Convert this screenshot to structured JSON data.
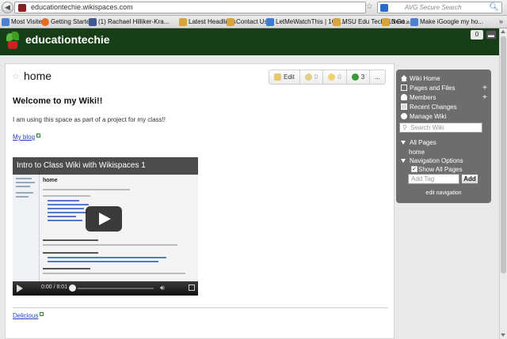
{
  "browser": {
    "url": "educationtechie.wikispaces.com",
    "search_placeholder": "AVG Secure Search",
    "bookmarks": [
      {
        "label": "Most Visited",
        "color": "#4a7fd6"
      },
      {
        "label": "Getting Started",
        "color": "#e66a1f"
      },
      {
        "label": "(1) Rachael Hilliker-Kra...",
        "color": "#3b5998"
      },
      {
        "label": "Latest Headlines",
        "color": "#d9a53a"
      },
      {
        "label": "Contact Us",
        "color": "#d9a53a"
      },
      {
        "label": "LetMeWatchThis | 1Ch...",
        "color": "#3a7bd5"
      },
      {
        "label": "MSU Edu Tech810 Go...",
        "color": "#d9a53a"
      },
      {
        "label": "Next »",
        "color": "#d9a53a"
      },
      {
        "label": "Make iGoogle my ho...",
        "color": "#4a7fd6"
      }
    ],
    "more_icon": "chevron-right-double"
  },
  "header": {
    "site_title": "educationtechie",
    "badge_count": "0"
  },
  "page": {
    "title": "home",
    "actions": {
      "edit_label": "Edit",
      "comments_count": "0",
      "favorites_count": "0",
      "revisions_count": "3",
      "more_label": "..."
    },
    "heading": "Welcome to my Wiki!!",
    "intro": "I am using this space as part of a project for my class!!",
    "blog_link": "My blog",
    "video": {
      "title": "Intro to Class Wiki with Wikispaces 1",
      "inner_page_title": "home",
      "time": "0:00 / 8:01"
    },
    "delicious_link": "Delicious"
  },
  "sidebar": {
    "items": [
      {
        "label": "Wiki Home",
        "icon": "home-icon"
      },
      {
        "label": "Pages and Files",
        "icon": "folder-icon",
        "plus": "+"
      },
      {
        "label": "Members",
        "icon": "members-icon",
        "plus": "+"
      },
      {
        "label": "Recent Changes",
        "icon": "recent-changes-icon"
      },
      {
        "label": "Manage Wiki",
        "icon": "gear-icon"
      }
    ],
    "search_placeholder": "Search Wiki",
    "all_pages_label": "All Pages",
    "all_pages_child": "home",
    "nav_options_label": "Navigation Options",
    "show_all_pages_label": "Show All Pages",
    "show_all_pages_checked": true,
    "tag_placeholder": "Add Tag",
    "tag_button": "Add",
    "edit_navigation": "edit navigation"
  }
}
